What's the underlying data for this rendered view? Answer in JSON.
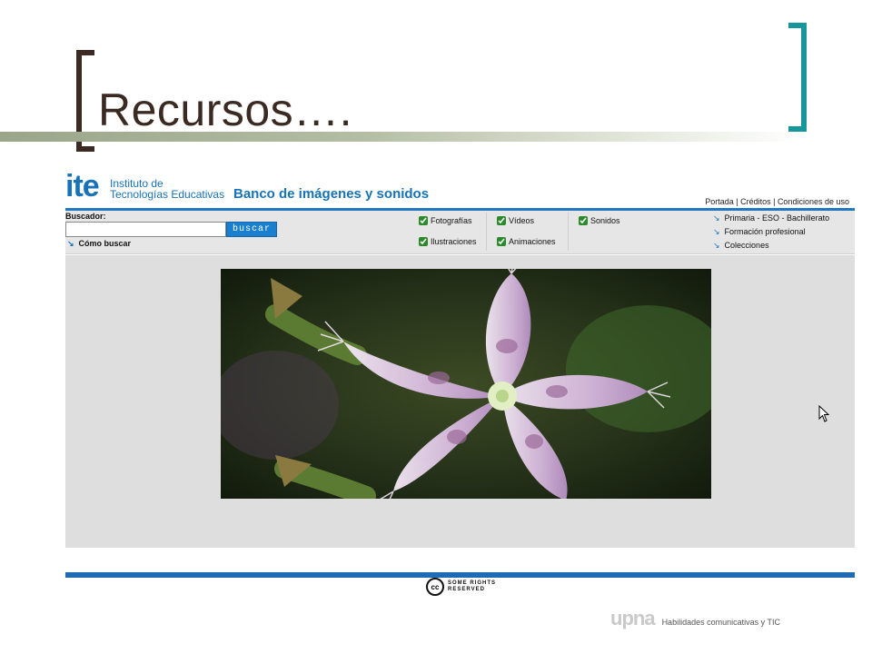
{
  "slide": {
    "title": "Recursos…."
  },
  "header": {
    "logo": "ite",
    "institute_line1": "Instituto de",
    "institute_line2": "Tecnologías Educativas",
    "banner": "Banco de imágenes y sonidos",
    "top_links": [
      "Portada",
      "Créditos",
      "Condiciones de uso"
    ]
  },
  "search": {
    "label": "Buscador:",
    "input_value": "",
    "button": "buscar",
    "help_link": "Cómo buscar"
  },
  "filters": {
    "fotografias": "Fotografías",
    "ilustraciones": "Ilustraciones",
    "videos": "Vídeos",
    "animaciones": "Animaciones",
    "sonidos": "Sonidos"
  },
  "right_links": [
    "Primaria - ESO - Bachillerato",
    "Formación profesional",
    "Colecciones"
  ],
  "footer": {
    "cc_line1": "SOME RIGHTS",
    "cc_line2": "RESERVED",
    "cc_symbol": "cc",
    "logo_text": "upna",
    "tagline": "Habilidades comunicativas y TIC"
  },
  "icons": {
    "arrow": "arrow-down-right-icon",
    "checkbox": "checkbox-checked-icon",
    "cursor": "mouse-pointer-icon"
  },
  "colors": {
    "brand_blue": "#1872b8",
    "title_color": "#3a2a22",
    "bracket_teal": "#17979b"
  }
}
